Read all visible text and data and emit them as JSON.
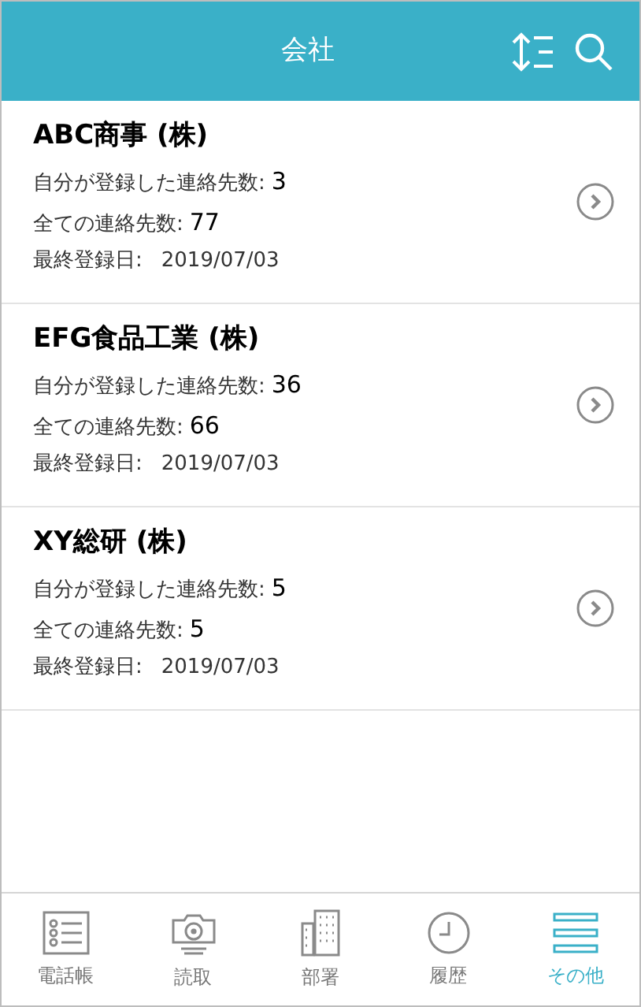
{
  "header": {
    "title": "会社"
  },
  "companies": [
    {
      "name": "ABC商事 (株)",
      "lines": [
        {
          "label": "自分が登録した連絡先数:",
          "value": "3"
        },
        {
          "label": "全ての連絡先数:",
          "value": "77"
        },
        {
          "label": "最終登録日:",
          "value": "2019/07/03"
        }
      ]
    },
    {
      "name": "EFG食品工業 (株)",
      "lines": [
        {
          "label": "自分が登録した連絡先数:",
          "value": "36"
        },
        {
          "label": "全ての連絡先数:",
          "value": "66"
        },
        {
          "label": "最終登録日:",
          "value": "2019/07/03"
        }
      ]
    },
    {
      "name": "XY総研 (株)",
      "lines": [
        {
          "label": "自分が登録した連絡先数:",
          "value": "5"
        },
        {
          "label": "全ての連絡先数:",
          "value": "5"
        },
        {
          "label": "最終登録日:",
          "value": "2019/07/03"
        }
      ]
    }
  ],
  "tabs": [
    {
      "label": "電話帳",
      "kind": "list",
      "selected": false
    },
    {
      "label": "読取",
      "kind": "camera",
      "selected": false
    },
    {
      "label": "部署",
      "kind": "building",
      "selected": false
    },
    {
      "label": "履歴",
      "kind": "clock",
      "selected": false
    },
    {
      "label": "その他",
      "kind": "menu",
      "selected": true
    }
  ]
}
